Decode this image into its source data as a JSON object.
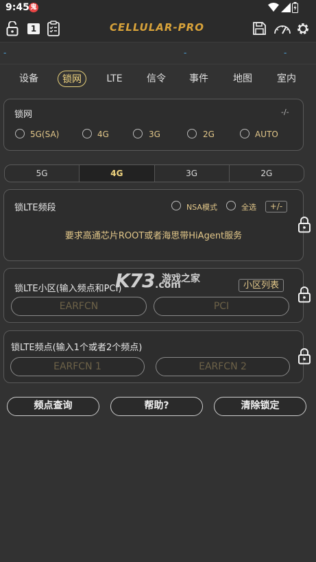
{
  "status_bar": {
    "time": "9:45",
    "notif_glyph": "鬼"
  },
  "app": {
    "logo": "CELLULAR-PRO",
    "badge": "1"
  },
  "info_row": {
    "d1": "-",
    "d2": "-",
    "d3": "-"
  },
  "tabs": [
    "设备",
    "锁网",
    "LTE",
    "信令",
    "事件",
    "地图",
    "室内"
  ],
  "active_tab": 1,
  "lock_net": {
    "title": "锁网",
    "value": "-/-",
    "options": [
      "5G(SA)",
      "4G",
      "3G",
      "2G",
      "AUTO"
    ]
  },
  "segment": {
    "items": [
      "5G",
      "4G",
      "3G",
      "2G"
    ],
    "active": 1
  },
  "band_card": {
    "title": "锁LTE频段",
    "nsa": "NSA模式",
    "select_all": "全选",
    "plusminus": "+/-",
    "message": "要求高通芯片ROOT或者海思带HiAgent服务"
  },
  "cell_card": {
    "title": "锁LTE小区(输入频点和PCI)",
    "list_btn": "小区列表",
    "earfcn_placeholder": "EARFCN",
    "pci_placeholder": "PCI"
  },
  "freq_card": {
    "title": "锁LTE频点(输入1个或者2个频点)",
    "earfcn1_placeholder": "EARFCN 1",
    "earfcn2_placeholder": "EARFCN 2"
  },
  "bottom": {
    "query": "频点查询",
    "help": "帮助?",
    "clear": "清除锁定"
  },
  "watermark": {
    "brand": "K73",
    "cn": "游戏之家",
    "domain": ".com"
  },
  "colors": {
    "accent": "#e3c88a",
    "info": "#4fa8e0",
    "background": "#323232"
  }
}
